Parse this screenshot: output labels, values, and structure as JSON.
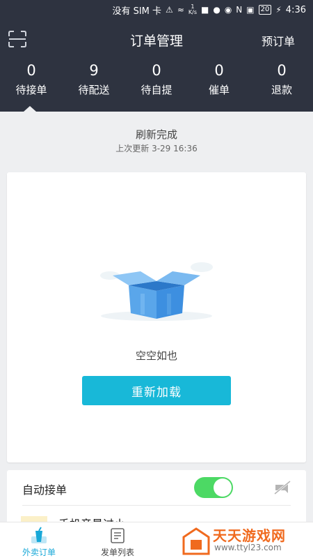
{
  "status_bar": {
    "carrier": "没有 SIM 卡",
    "speed_value": "1",
    "speed_unit": "K/s",
    "battery": "20",
    "time": "4:36"
  },
  "header": {
    "title": "订单管理",
    "preorder_label": "预订单",
    "scan_icon": "scan-icon"
  },
  "tabs": [
    {
      "count": "0",
      "label": "待接单"
    },
    {
      "count": "9",
      "label": "待配送"
    },
    {
      "count": "0",
      "label": "待自提"
    },
    {
      "count": "0",
      "label": "催单"
    },
    {
      "count": "0",
      "label": "退款"
    }
  ],
  "refresh": {
    "title": "刷新完成",
    "last_update": "上次更新 3-29 16:36"
  },
  "empty_state": {
    "text": "空空如也",
    "reload_label": "重新加载",
    "illustration": "empty-box-icon"
  },
  "auto_accept": {
    "label": "自动接单",
    "enabled": true,
    "volume_warning": "手机音量过小"
  },
  "bottom_nav": {
    "items": [
      {
        "label": "外卖订单",
        "icon": "cup-icon",
        "active": true
      },
      {
        "label": "发单列表",
        "icon": "list-icon",
        "active": false
      }
    ]
  },
  "watermark": {
    "title": "天天游戏网",
    "url": "www.ttyl23.com"
  },
  "colors": {
    "header_bg": "#2e3340",
    "accent": "#18b8d8",
    "toggle_on": "#4cd964",
    "watermark": "#f06a1e"
  }
}
